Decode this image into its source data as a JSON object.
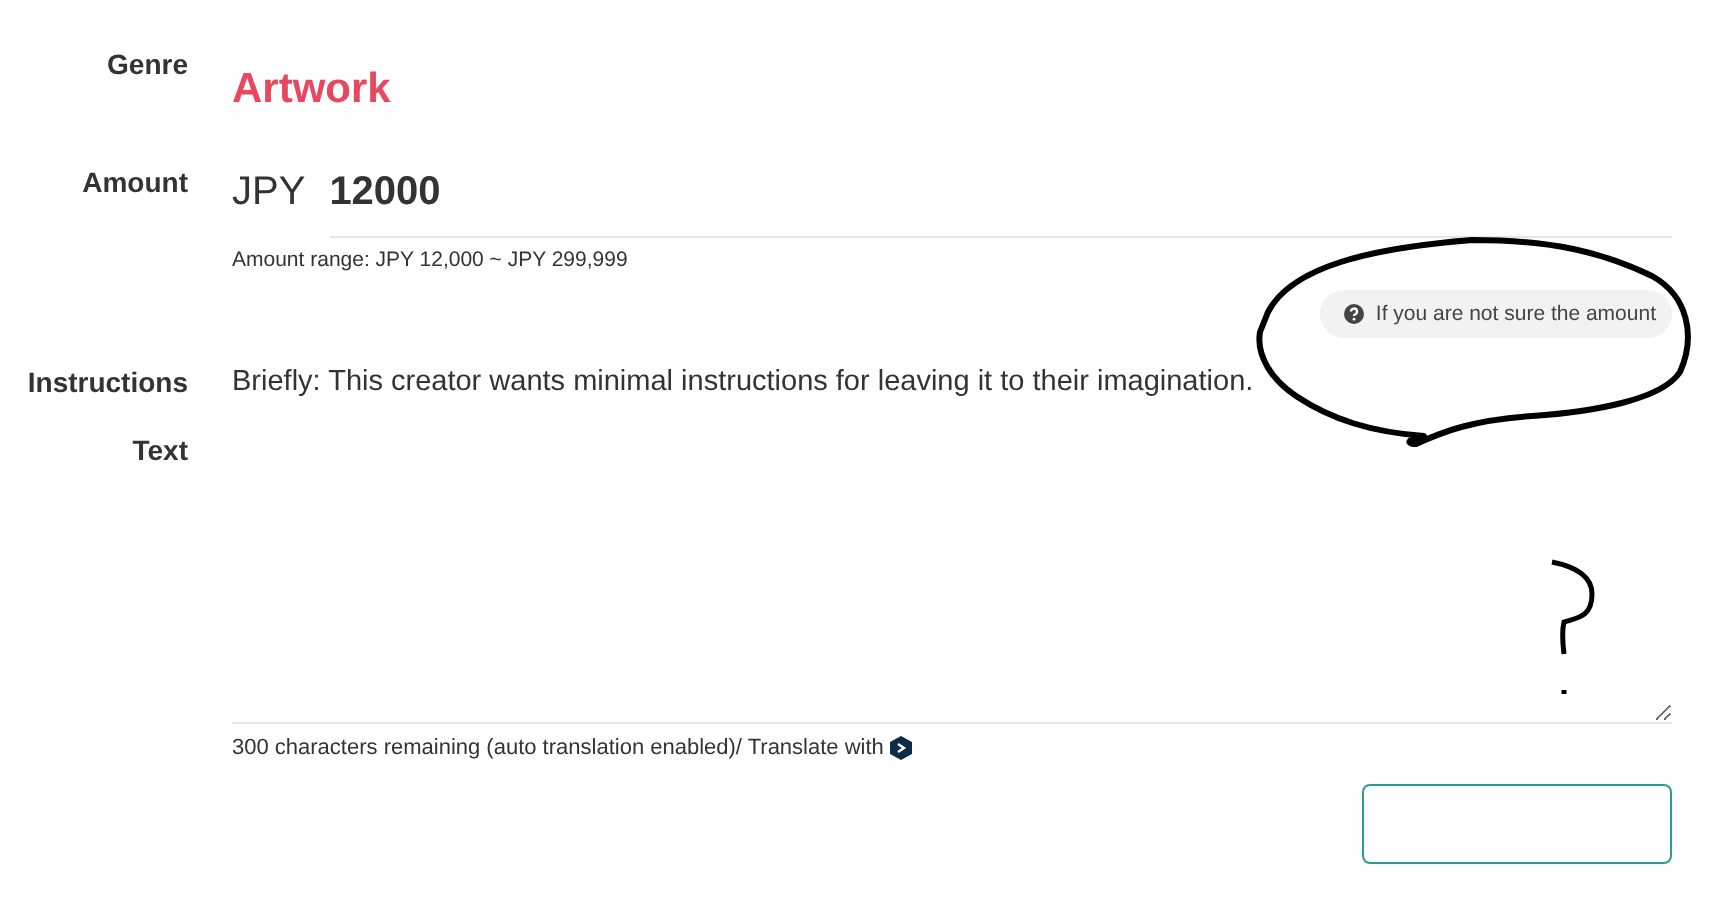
{
  "fields": [
    {
      "kind": "genre",
      "label": "Genre",
      "value": "Artwork"
    },
    {
      "kind": "amount",
      "label": "Amount",
      "currency": "JPY",
      "value": "12000",
      "hint": "Amount range: JPY 12,000 ~ JPY 299,999",
      "help": "If you are not sure the amount"
    },
    {
      "kind": "static",
      "label": "Instructions",
      "value": "Briefly: This creator wants minimal instructions for leaving it to their imagination."
    },
    {
      "kind": "textarea",
      "label": "Text",
      "counter": "300 characters remaining (auto translation enabled)/ Translate with"
    }
  ]
}
